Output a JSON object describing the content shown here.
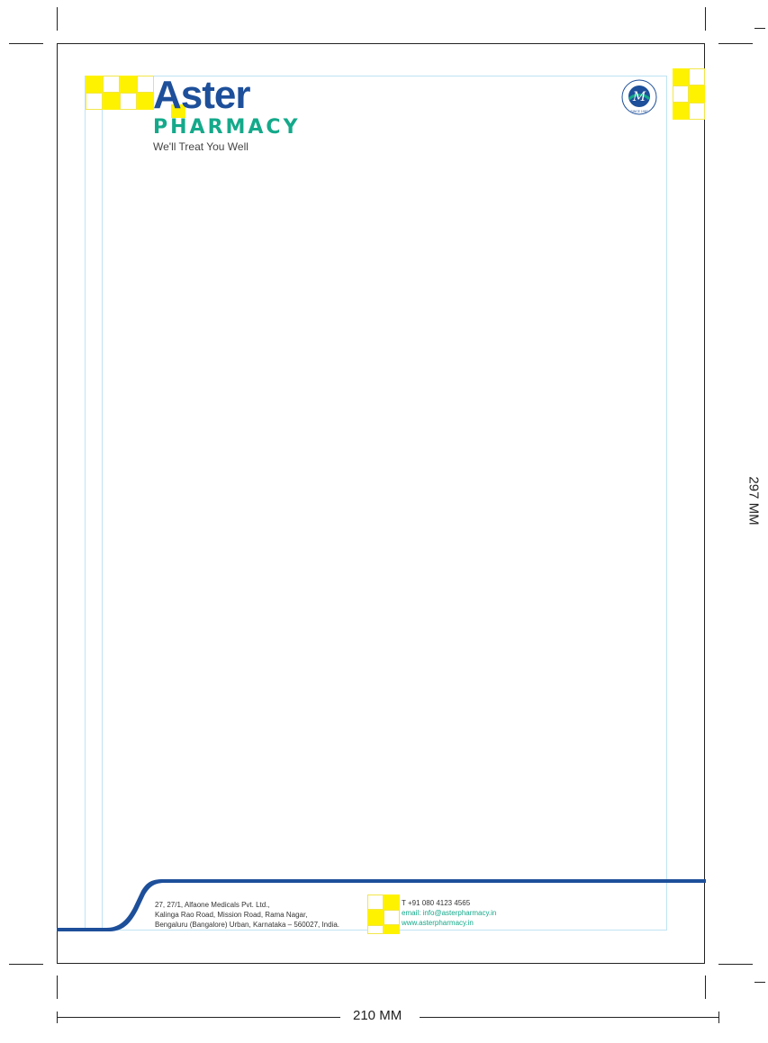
{
  "brand": {
    "name": "Aster",
    "sub": "PHARMACY",
    "tagline": "We'll Treat You Well"
  },
  "seal": {
    "ring_text": "ASTER DM HEALTHCARE",
    "since": "SINCE 1987",
    "monogram": "M"
  },
  "footer": {
    "address": [
      "27, 27/1, Alfaone Medicals Pvt. Ltd.,",
      "Kalinga Rao Road, Mission Road, Rama Nagar,",
      "Bengaluru (Bangalore) Urban, Karnataka – 560027, India."
    ],
    "phone": "T +91 080 4123 4565",
    "email": "email: info@asterpharmacy.in",
    "web": "www.asterpharmacy.in"
  },
  "dimensions": {
    "width_label": "210 MM",
    "height_label": "297 MM"
  },
  "colors": {
    "brand_blue": "#1d4f9a",
    "brand_green": "#14a98a",
    "accent_yellow": "#fff200"
  }
}
